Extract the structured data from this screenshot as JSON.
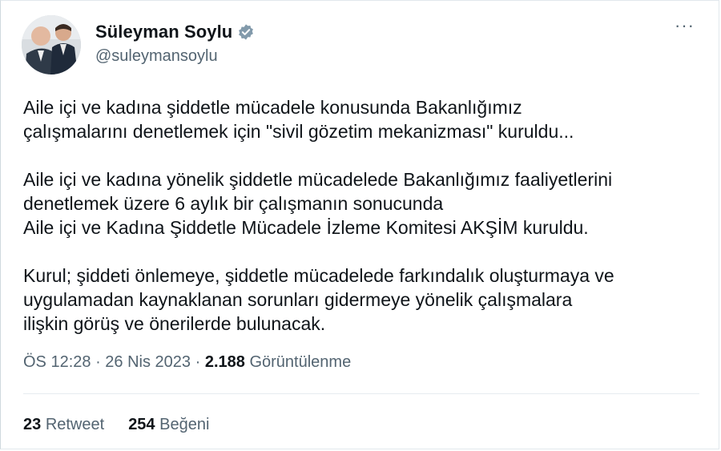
{
  "user": {
    "display_name": "Süleyman Soylu",
    "handle": "@suleymansoylu",
    "verified": true
  },
  "menu": {
    "more_label": "···"
  },
  "tweet": {
    "paragraphs": [
      "Aile içi ve kadına şiddetle mücadele konusunda Bakanlığımız\nçalışmalarını denetlemek için \"sivil gözetim mekanizması\" kuruldu...",
      "Aile içi ve kadına yönelik şiddetle mücadelede Bakanlığımız faaliyetlerini\ndenetlemek üzere 6 aylık bir çalışmanın sonucunda\nAile içi ve Kadına Şiddetle Mücadele İzleme Komitesi AKŞİM kuruldu.",
      "Kurul; şiddeti önlemeye, şiddetle mücadelede farkındalık oluşturmaya ve\nuygulamadan kaynaklanan sorunları gidermeye yönelik çalışmalara\nilişkin görüş ve önerilerde bulunacak."
    ],
    "time": "ÖS 12:28",
    "separator": " · ",
    "date": "26 Nis 2023",
    "views_count": "2.188",
    "views_label": "Görüntülenme"
  },
  "stats": {
    "retweets_count": "23",
    "retweets_label": "Retweet",
    "likes_count": "254",
    "likes_label": "Beğeni"
  },
  "colors": {
    "text": "#0f1419",
    "muted": "#536471",
    "verified_badge": "#829aab"
  },
  "icons": {
    "verified": "verified-badge-icon",
    "more": "more-options-icon"
  }
}
